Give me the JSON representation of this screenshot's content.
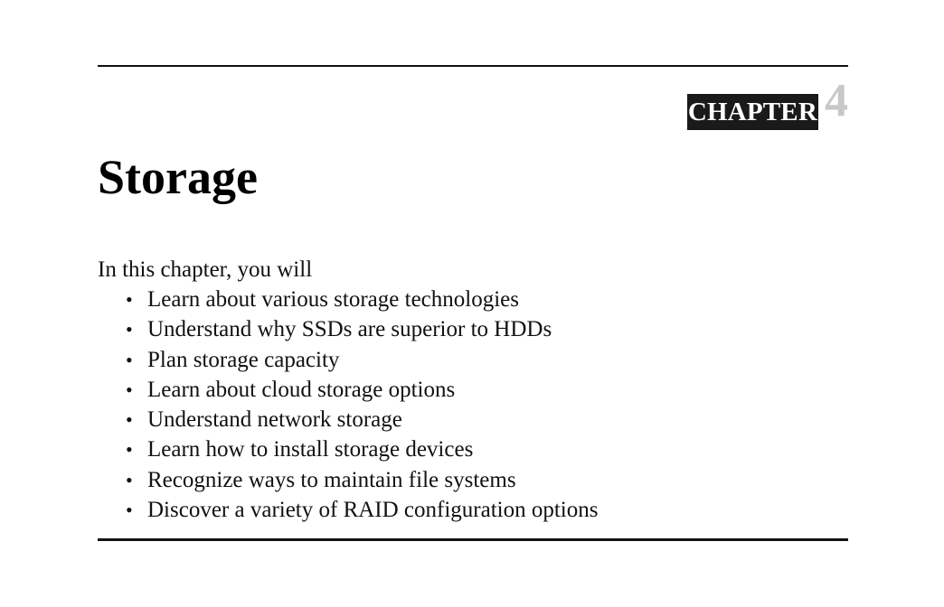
{
  "chapter": {
    "label": "CHAPTER",
    "number": "4"
  },
  "title": "Storage",
  "intro": "In this chapter, you will",
  "objectives": [
    "Learn about various storage technologies",
    "Understand why SSDs are superior to HDDs",
    "Plan storage capacity",
    "Learn about cloud storage options",
    "Understand network storage",
    "Learn how to install storage devices",
    "Recognize ways to maintain file systems",
    "Discover a variety of RAID configuration options"
  ],
  "colors": {
    "text": "#111111",
    "chapter_label_bg": "#1a1a1a",
    "chapter_number": "#c8c8c8"
  }
}
